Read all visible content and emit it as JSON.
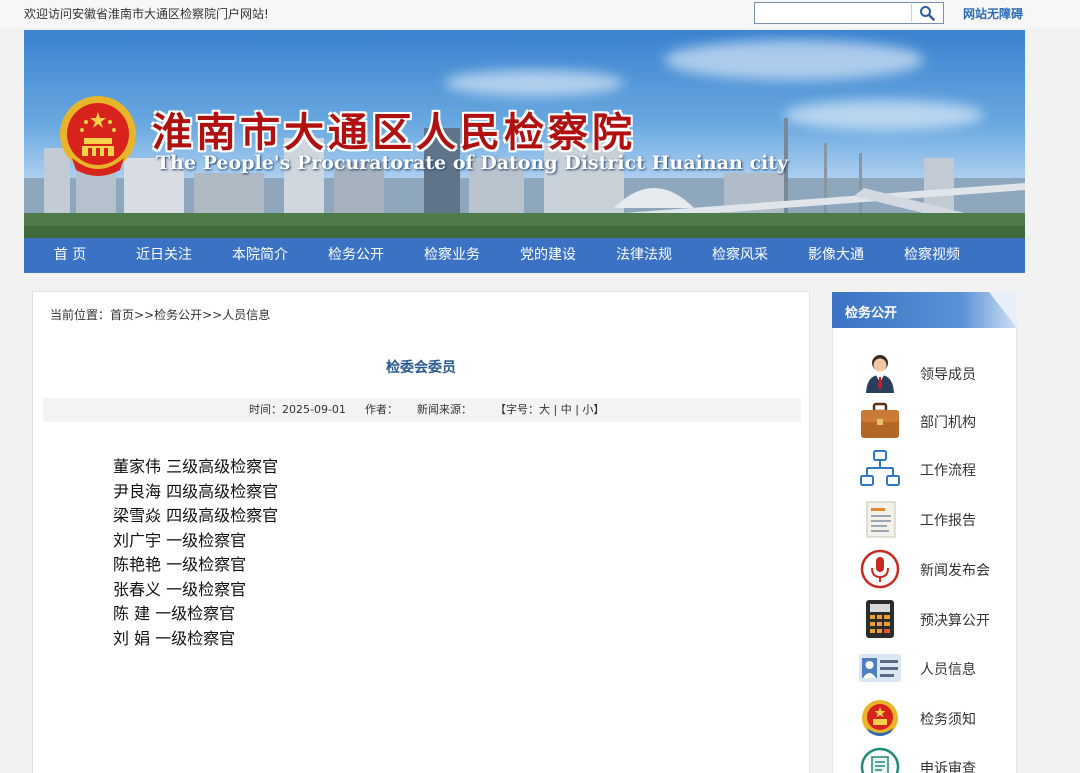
{
  "topbar": {
    "welcome": "欢迎访问安徽省淮南市大通区检察院门户网站!",
    "search_placeholder": "",
    "accessibility": "网站无障碍"
  },
  "banner": {
    "title_cn": "淮南市大通区人民检察院",
    "title_en": "The People's Procuratorate of Datong District Huainan city"
  },
  "nav": [
    "首 页",
    "近日关注",
    "本院简介",
    "检务公开",
    "检察业务",
    "党的建设",
    "法律法规",
    "检察风采",
    "影像大通",
    "检察视频"
  ],
  "breadcrumb": "当前位置：首页>>检务公开>>人员信息",
  "article": {
    "title": "检委会委员",
    "meta": {
      "time": "时间：2025-09-01",
      "author": "作者：",
      "source": "新闻来源：",
      "font_size_prefix": "【字号：",
      "large": "大",
      "sep": " | ",
      "medium": "中",
      "small": "小",
      "suffix": "】"
    },
    "members": [
      "董家伟 三级高级检察官",
      "尹良海 四级高级检察官",
      "梁雪焱 四级高级检察官",
      "刘广宇 一级检察官",
      "陈艳艳 一级检察官",
      "张春义 一级检察官",
      "陈 建 一级检察官",
      "刘 娟 一级检察官"
    ]
  },
  "sidebar": {
    "heading": "检务公开",
    "items": [
      {
        "label": "领导成员",
        "icon": "leader-icon"
      },
      {
        "label": "部门机构",
        "icon": "briefcase-icon"
      },
      {
        "label": "工作流程",
        "icon": "flowchart-icon"
      },
      {
        "label": "工作报告",
        "icon": "report-icon"
      },
      {
        "label": "新闻发布会",
        "icon": "microphone-icon"
      },
      {
        "label": "预决算公开",
        "icon": "calculator-icon"
      },
      {
        "label": "人员信息",
        "icon": "id-card-icon"
      },
      {
        "label": "检务须知",
        "icon": "procuratorate-emblem-icon"
      },
      {
        "label": "申诉审查",
        "icon": "document-icon"
      }
    ]
  },
  "colors": {
    "nav_bg": "#3b72c4",
    "title_red": "#b01010",
    "link_blue": "#2e6bb6"
  }
}
